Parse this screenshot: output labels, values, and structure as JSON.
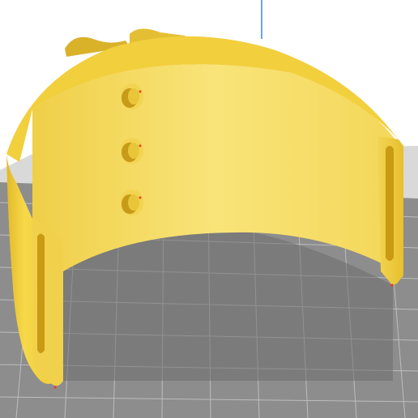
{
  "viewport": {
    "background_color": "#ffffff",
    "axis_line_color": "#3b82f6"
  },
  "build_plate": {
    "fill_color": "#8a8a8a",
    "far_fill_color": "#dcdcdc",
    "grid_color": "#c9c9c9"
  },
  "model": {
    "color_outer": "#f5d442",
    "color_inner": "#f8e170",
    "color_shadow": "#d9ac1e",
    "color_edge": "#b88c12",
    "overhang_marker_color": "#e8402c",
    "slotted_ends": 2,
    "mount_holes_visible": 3
  }
}
